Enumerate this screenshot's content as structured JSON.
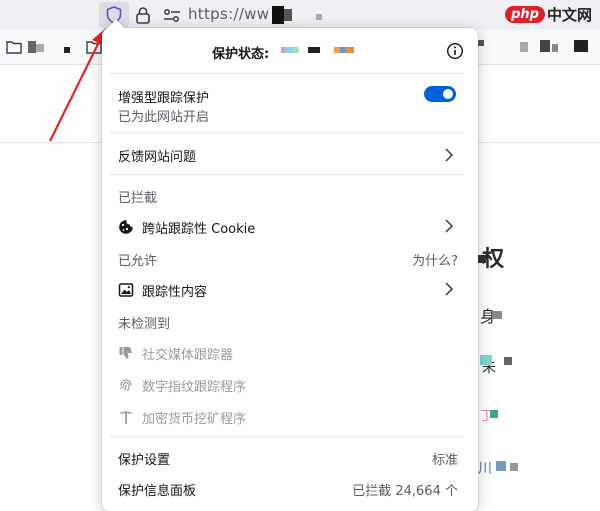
{
  "urlbar": {
    "url_text": "https://ww"
  },
  "watermark": {
    "logo": "php",
    "text": "中文网"
  },
  "page_chars": [
    "权",
    "身",
    "未",
    "丁",
    "川"
  ],
  "panel": {
    "header": {
      "title": "保护状态:"
    },
    "enhanced": {
      "title": "增强型跟踪保护",
      "subtitle": "已为此网站开启",
      "toggle_on": true
    },
    "report_issue": "反馈网站问题",
    "blocked": {
      "section_label": "已拦截",
      "items": [
        {
          "icon": "cookie-icon",
          "label": "跨站跟踪性 Cookie"
        }
      ]
    },
    "allowed": {
      "section_label": "已允许",
      "why_label": "为什么?",
      "items": [
        {
          "icon": "image-icon",
          "label": "跟踪性内容"
        }
      ]
    },
    "not_detected": {
      "section_label": "未检测到",
      "items": [
        {
          "icon": "thumbs-down-icon",
          "label": "社交媒体跟踪器"
        },
        {
          "icon": "fingerprint-icon",
          "label": "数字指纹跟踪程序"
        },
        {
          "icon": "pickaxe-icon",
          "label": "加密货币挖矿程序"
        }
      ]
    },
    "settings": {
      "label": "保护设置",
      "value": "标准"
    },
    "dashboard": {
      "label": "保护信息面板",
      "value": "已拦截 24,664 个"
    }
  },
  "colors": {
    "accent": "#0061e0",
    "arrow": "#e8231e",
    "shield": "#5a4fd1"
  }
}
